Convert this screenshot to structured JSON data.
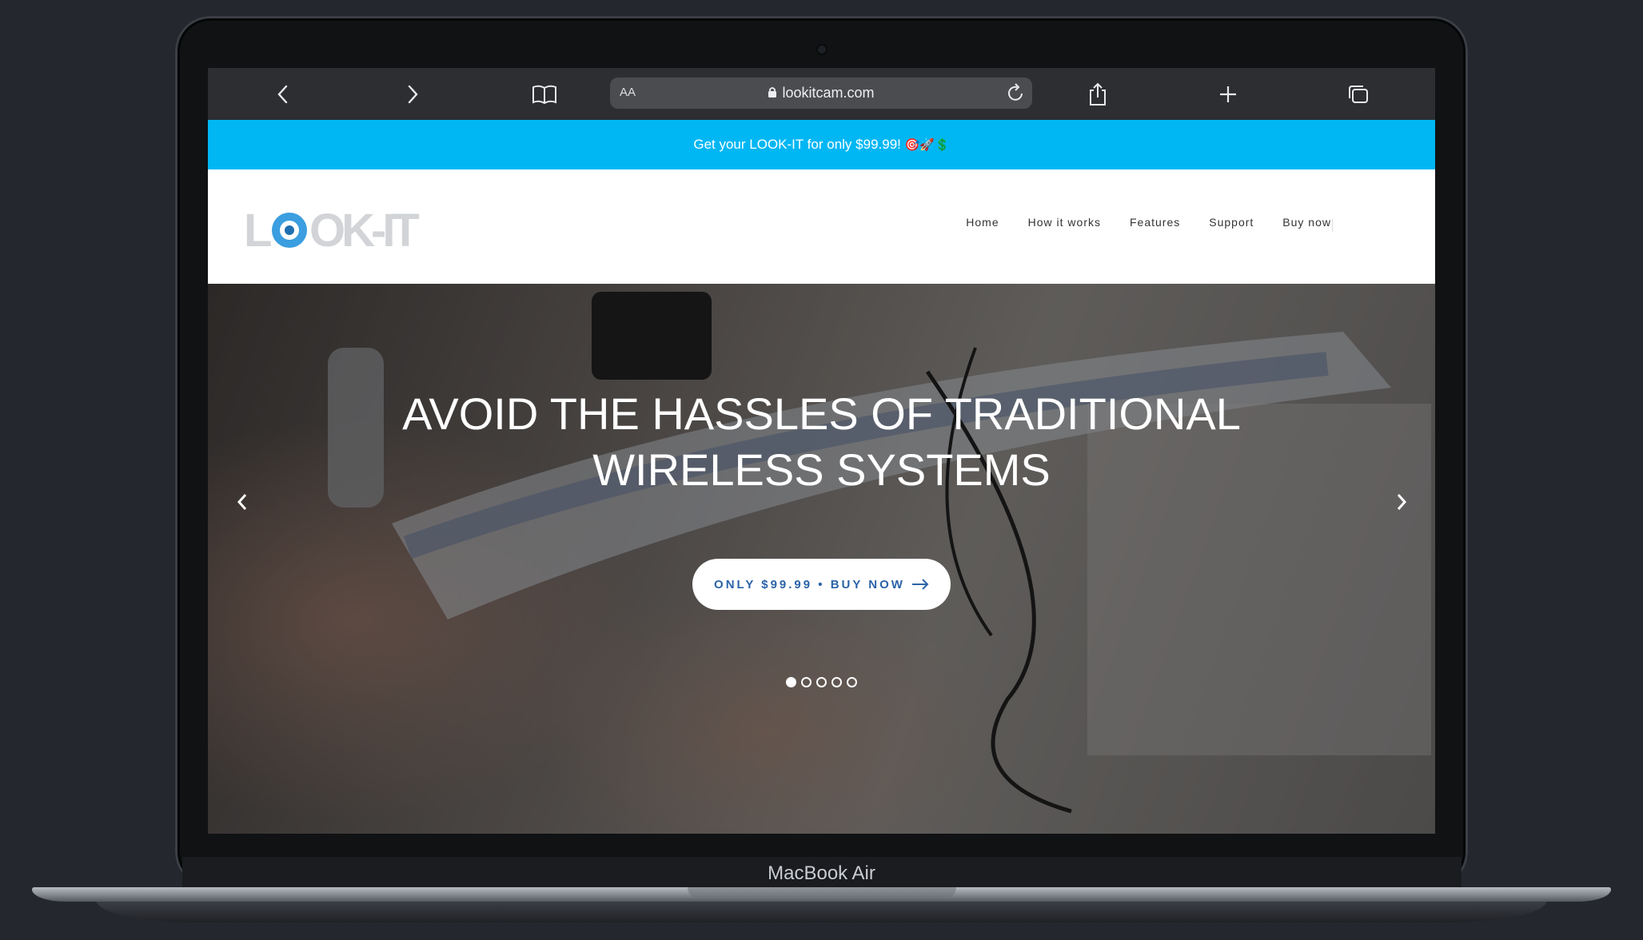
{
  "device": {
    "label": "MacBook Air"
  },
  "browser": {
    "url_aa": "AA",
    "url": "lookitcam.com",
    "icons": [
      "chevron-left-icon",
      "chevron-right-icon",
      "book-icon",
      "lock-icon",
      "reload-icon",
      "share-icon",
      "plus-icon",
      "tabs-icon"
    ]
  },
  "announcement": {
    "text": "Get your LOOK-IT for only $99.99!",
    "emojis": "🎯🚀💲"
  },
  "header": {
    "logo_text": "LOOK-IT",
    "nav": [
      "Home",
      "How it works",
      "Features",
      "Support",
      "Buy now"
    ]
  },
  "hero": {
    "title_line1": "AVOID THE HASSLES OF TRADITIONAL",
    "title_line2": "WIRELESS SYSTEMS",
    "cta": "ONLY $99.99 • BUY NOW",
    "slides_total": 5,
    "active_slide": 1
  },
  "colors": {
    "accent": "#00b7f4",
    "cta_text": "#2b63a8",
    "toolbar": "#2c2e31"
  }
}
